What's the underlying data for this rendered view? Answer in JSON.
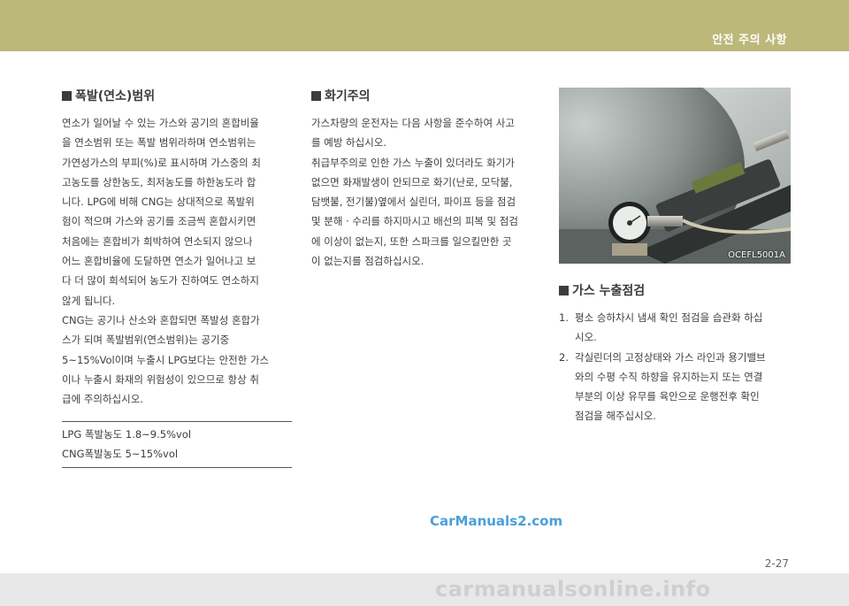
{
  "header": {
    "title": "안전 주의 사항"
  },
  "left": {
    "heading": "폭발(연소)범위",
    "lines": [
      "연소가 일어날 수 있는 가스와 공기의 혼합비율",
      "을 연소범위 또는 폭발 범위라하며 연소범위는",
      "가연성가스의 부피(%)로 표시하며 가스중의 최",
      "고농도를 상한농도, 최저농도를 하한농도라 합",
      "니다. LPG에 비해 CNG는 상대적으로 폭발위",
      "험이 적으며 가스와 공기를 조금씩 혼합시키면",
      "처음에는 혼합비가 희박하여 연소되지 않으나",
      "어느 혼합비율에 도달하면 연소가 일어나고 보",
      "다 더 많이 희석되어 농도가 진하여도 연소하지",
      "않게 됩니다.",
      "CNG는 공기나 산소와 혼합되면 폭발성 혼합가",
      "스가 되며 폭발범위(연소범위)는 공기중",
      "5~15%Vol이며 누출시 LPG보다는 안전한 가스",
      "이나 누출시 화재의 위험성이 있으므로 항상 취",
      "급에 주의하십시오."
    ],
    "box": [
      "LPG 폭발농도 1.8~9.5%vol",
      "CNG폭발농도 5~15%vol"
    ]
  },
  "middle": {
    "heading": "화기주의",
    "lines": [
      "가스차량의 운전자는 다음 사항을 준수하여 사고",
      "를 예방 하십시오.",
      "취급부주의로 인한 가스 누출이 있더라도 화기가",
      "없으면 화재발생이 안되므로 화기(난로, 모닥불,",
      "담뱃불, 전기불)옆에서 실린더, 파이프 등을 점검",
      "및 분해 · 수리를 하지마시고 배선의 피복 및 점검",
      "에 이상이 없는지, 또한 스파크를 일으킬만한 곳",
      "이 없는지를 점검하십시오."
    ]
  },
  "right": {
    "photo_code": "OCEFL5001A",
    "heading": "가스 누출점검",
    "items": [
      {
        "num": "1.",
        "lines": [
          "평소 승하차시 냄새 확인 점검을 습관화 하십",
          "시오."
        ]
      },
      {
        "num": "2.",
        "lines": [
          "각실린더의 고정상태와 가스 라인과 용기밸브",
          "와의 수평 수직 하향을 유지하는지 또는 연결",
          "부분의 이상 유무를 육안으로 운행전후 확인",
          "점검을 해주십시오."
        ]
      }
    ]
  },
  "watermark": "CarManuals2.com",
  "page_number": "2-27",
  "footer": "carmanualsonline.info"
}
